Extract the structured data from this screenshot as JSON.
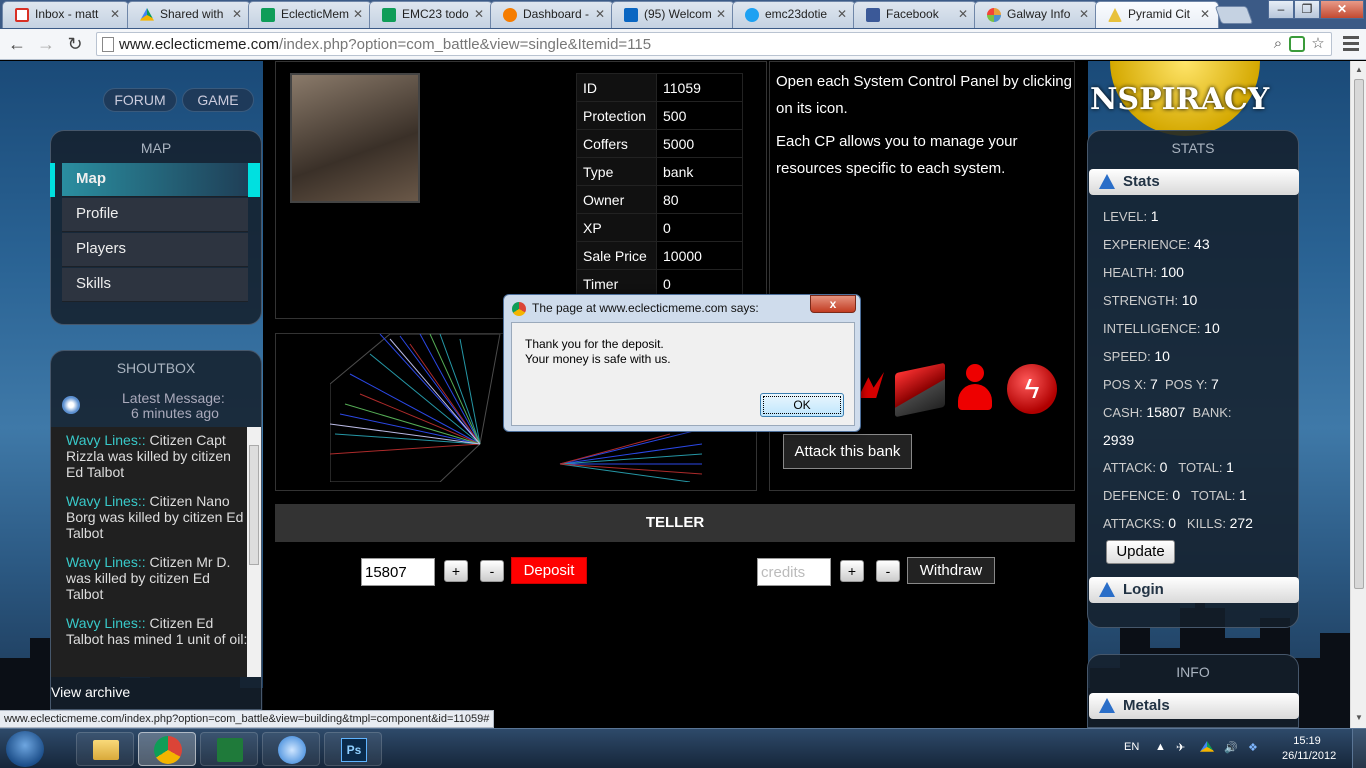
{
  "browser": {
    "tabs": [
      {
        "label": "Inbox - matt",
        "icon": "gmail-icon",
        "color": "#d93025"
      },
      {
        "label": "Shared with",
        "icon": "drive-icon",
        "color": "#f4b400"
      },
      {
        "label": "EclecticMem",
        "icon": "sheets-icon",
        "color": "#0f9d58"
      },
      {
        "label": "EMC23 todo",
        "icon": "sheets-icon",
        "color": "#0f9d58"
      },
      {
        "label": "Dashboard -",
        "icon": "dashboard-icon",
        "color": "#f57c00"
      },
      {
        "label": "(95) Welcom",
        "icon": "linkedin-icon",
        "color": "#0a66c2"
      },
      {
        "label": "emc23dotie",
        "icon": "twitter-icon",
        "color": "#1da1f2"
      },
      {
        "label": "Facebook",
        "icon": "facebook-icon",
        "color": "#3b5998"
      },
      {
        "label": "Galway Info",
        "icon": "joomla-icon",
        "color": "#e8a03b"
      },
      {
        "label": "Pyramid Cit",
        "icon": "pyramid-icon",
        "color": "#e8c13b"
      }
    ],
    "url_domain": "www.eclecticmeme.com",
    "url_path": "/index.php?option=com_battle&view=single&Itemid=115",
    "status_url": "www.eclecticmeme.com/index.php?option=com_battle&view=building&tmpl=component&id=11059#"
  },
  "topnav": [
    "FORUM",
    "GAME"
  ],
  "map_panel": {
    "title": "MAP",
    "items": [
      "Map",
      "Profile",
      "Players",
      "Skills"
    ]
  },
  "shoutbox": {
    "title": "SHOUTBOX",
    "latest_label": "Latest Message:",
    "latest_time": "6 minutes ago",
    "messages": [
      {
        "who": "Wavy Lines::",
        "text": " Citizen Capt Rizzla was killed by citizen Ed Talbot"
      },
      {
        "who": "Wavy Lines::",
        "text": " Citizen Nano Borg was killed by citizen Ed Talbot"
      },
      {
        "who": "Wavy Lines::",
        "text": " Citizen Mr D. was killed by citizen Ed Talbot"
      },
      {
        "who": "Wavy Lines::",
        "text": " Citizen Ed Talbot has mined 1 unit of oil:"
      }
    ],
    "archive_link": "View archive"
  },
  "building": {
    "rows": [
      {
        "k": "ID",
        "v": "11059"
      },
      {
        "k": "Protection",
        "v": "500"
      },
      {
        "k": "Coffers",
        "v": "5000"
      },
      {
        "k": "Type",
        "v": "bank"
      },
      {
        "k": "Owner",
        "v": "80"
      },
      {
        "k": "XP",
        "v": "0"
      },
      {
        "k": "Sale Price",
        "v": "10000"
      },
      {
        "k": "Timer",
        "v": "0"
      }
    ]
  },
  "instructions": {
    "p1": "Open each System Control Panel by clicking on its icon.",
    "p2": "Each CP allows you to manage your resources specific to each system."
  },
  "attack_button": "Attack this bank",
  "teller": {
    "title": "TELLER",
    "deposit_value": "15807",
    "deposit_label": "Deposit",
    "withdraw_placeholder": "credits",
    "withdraw_label": "Withdraw",
    "plus": "+",
    "minus": "-"
  },
  "banner_text": "NSPIRACY",
  "stats_panel": {
    "title": "STATS",
    "header": "Stats",
    "level_label": "LEVEL:",
    "level": "1",
    "experience_label": "EXPERIENCE:",
    "experience": "43",
    "health_label": "HEALTH:",
    "health": "100",
    "strength_label": "STRENGTH:",
    "strength": "10",
    "intelligence_label": "INTELLIGENCE:",
    "intelligence": "10",
    "speed_label": "SPEED:",
    "speed": "10",
    "posx_label": "POS X:",
    "posx": "7",
    "posy_label": "POS Y:",
    "posy": "7",
    "cash_label": "CASH:",
    "cash": "15807",
    "bank_label": "BANK:",
    "bank": "2939",
    "attack_label": "ATTACK:",
    "attack": "0",
    "attack_total_label": "TOTAL:",
    "attack_total": "1",
    "defence_label": "DEFENCE:",
    "defence": "0",
    "defence_total_label": "TOTAL:",
    "defence_total": "1",
    "attacks_label": "ATTACKS:",
    "attacks": "0",
    "kills_label": "KILLS:",
    "kills": "272",
    "update_label": "Update",
    "login_label": "Login"
  },
  "info_panel": {
    "title": "INFO",
    "metals_label": "Metals"
  },
  "dialog": {
    "title": "The page at www.eclecticmeme.com says:",
    "line1": "Thank you for the deposit.",
    "line2": "Your money is safe with us.",
    "ok_label": "OK",
    "close_label": "x"
  },
  "taskbar": {
    "lang": "EN",
    "time": "15:19",
    "date": "26/11/2012",
    "photoshop_label": "Ps"
  }
}
